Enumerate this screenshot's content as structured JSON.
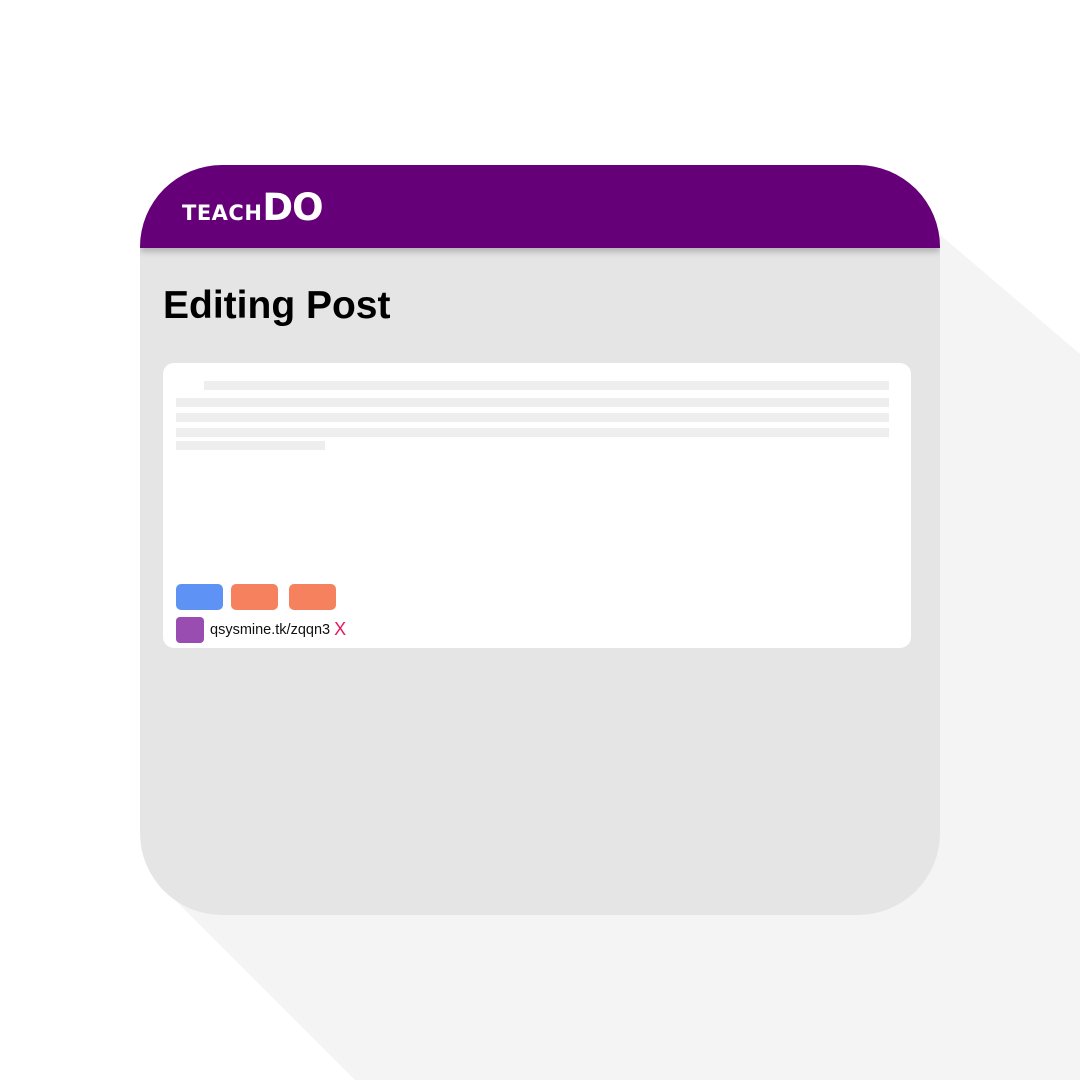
{
  "app": {
    "logo_prefix": "TEACH",
    "logo_suffix": "DO"
  },
  "page": {
    "title": "Editing Post"
  },
  "post": {
    "attachment": {
      "link_text": "qsysmine.tk/zqqn3",
      "remove_label": "X"
    }
  },
  "colors": {
    "header": "#660078",
    "window": "#e5e5e5",
    "card": "#ffffff",
    "blue_button": "#5e93f5",
    "orange_button": "#f6815e",
    "attachment_thumb": "#9a4db0",
    "remove": "#e8185c"
  }
}
